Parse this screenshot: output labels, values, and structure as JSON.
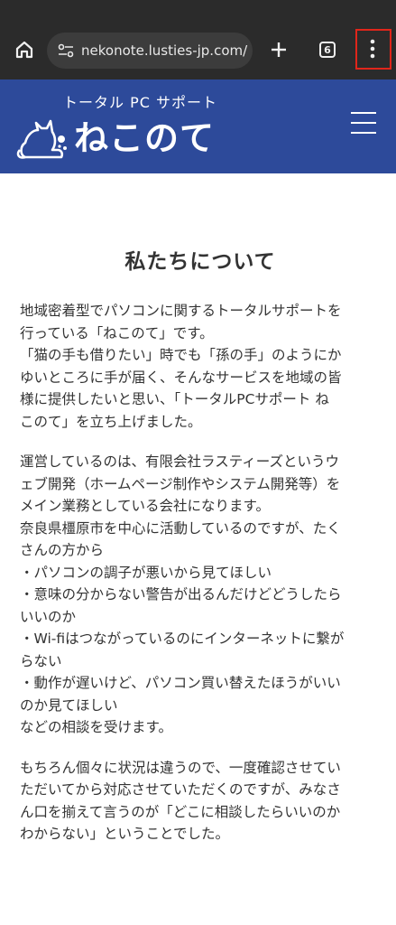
{
  "browser": {
    "url": "nekonote.lusties-jp.com/",
    "tab_count": "6"
  },
  "header": {
    "tagline": "トータル PC サポート",
    "wordmark": "ねこのて",
    "colors": {
      "header_bg": "#2d4a9a",
      "browser_bg": "#2b2b2b",
      "highlight": "#e0261b"
    }
  },
  "main": {
    "title": "私たちについて",
    "paragraphs": [
      {
        "lines": [
          "地域密着型でパソコンに関するトータルサポートを",
          "行っている「ねこのて」です。",
          "「猫の手も借りたい」時でも「孫の手」のようにか",
          "ゆいところに手が届く、そんなサービスを地域の皆",
          "様に提供したいと思い、「トータルPCサポート ね",
          "このて」を立ち上げました。"
        ]
      },
      {
        "lines": [
          "運営しているのは、有限会社ラスティーズというウ",
          "ェブ開発（ホームページ制作やシステム開発等）を",
          "メイン業務としている会社になります。",
          "奈良県橿原市を中心に活動しているのですが、たく",
          "さんの方から",
          "・パソコンの調子が悪いから見てほしい",
          "・意味の分からない警告が出るんだけどどうしたら",
          "いいのか",
          "・Wi-fiはつながっているのにインターネットに繋が",
          "らない",
          "・動作が遅いけど、パソコン買い替えたほうがいい",
          "のか見てほしい",
          "などの相談を受けます。"
        ]
      },
      {
        "lines": [
          "もちろん個々に状況は違うので、一度確認させてい",
          "ただいてから対応させていただくのですが、みなさ",
          "ん口を揃えて言うのが「どこに相談したらいいのか",
          "わからない」ということでした。"
        ]
      }
    ]
  }
}
